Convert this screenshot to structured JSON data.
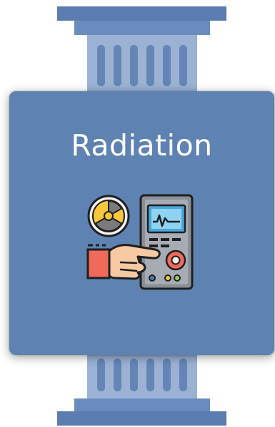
{
  "card": {
    "title": "Radiation",
    "icon": "radiation-detector-icon"
  },
  "colors": {
    "card": "#5e82b1",
    "pillar_shaft": "#9bb2d4",
    "pillar_flute": "#6585b6",
    "capital": "#5a7caf",
    "title_text": "#ffffff"
  }
}
